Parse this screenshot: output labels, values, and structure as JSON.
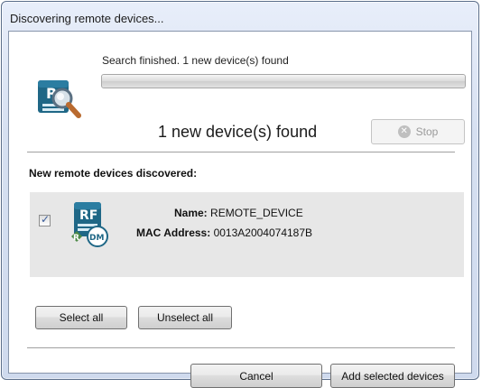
{
  "window": {
    "title": "Discovering remote devices..."
  },
  "discovery": {
    "status_text": "Search finished. 1 new device(s) found",
    "progress_percent": 100,
    "found_text": "1 new device(s) found",
    "stop_label": "Stop",
    "stop_enabled": false
  },
  "devices_section": {
    "heading": "New remote devices discovered:",
    "devices": [
      {
        "checked": true,
        "name_label": "Name:",
        "name_value": "REMOTE_DEVICE",
        "mac_label": "MAC Address:",
        "mac_value": "0013A2004074187B"
      }
    ]
  },
  "selection": {
    "select_all_label": "Select all",
    "unselect_all_label": "Unselect all"
  },
  "footer": {
    "cancel_label": "Cancel",
    "add_label": "Add selected devices"
  },
  "colors": {
    "frame_blue": "#d6e0f1",
    "device_row_bg": "#e7e7e7",
    "icon_teal": "#1f6786",
    "icon_green": "#4d8a47",
    "magnifier_orange": "#b96a2f"
  },
  "icons": {
    "search_device": "device-search-icon",
    "remote_device": "remote-device-icon",
    "stop": "stop-icon",
    "checkmark": "checkmark-icon"
  }
}
